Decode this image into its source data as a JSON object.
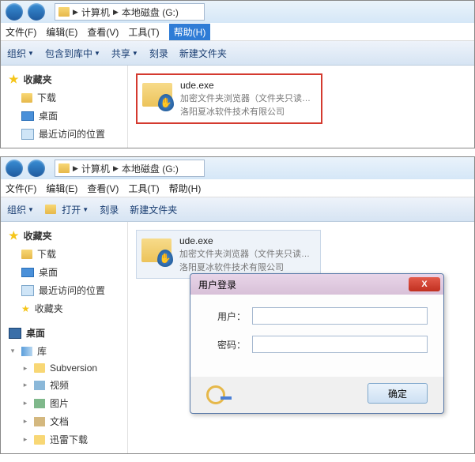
{
  "win1": {
    "breadcrumb": {
      "computer": "计算机",
      "disk": "本地磁盘 (G:)"
    },
    "menu": {
      "file": "文件(F)",
      "edit": "编辑(E)",
      "view": "查看(V)",
      "tools": "工具(T)",
      "help": "帮助(H)",
      "help_active": true
    },
    "toolbar": {
      "organize": "组织",
      "include": "包含到库中",
      "share": "共享",
      "burn": "刻录",
      "newfolder": "新建文件夹"
    },
    "sidebar": {
      "fav": "收藏夹",
      "downloads": "下载",
      "desktop": "桌面",
      "recent": "最近访问的位置"
    },
    "file": {
      "name": "ude.exe",
      "desc1": "加密文件夹浏览器（文件夹只读…",
      "desc2": "洛阳夏冰软件技术有限公司"
    }
  },
  "win2": {
    "breadcrumb": {
      "computer": "计算机",
      "disk": "本地磁盘 (G:)"
    },
    "menu": {
      "file": "文件(F)",
      "edit": "编辑(E)",
      "view": "查看(V)",
      "tools": "工具(T)",
      "help": "帮助(H)"
    },
    "toolbar": {
      "organize": "组织",
      "open": "打开",
      "burn": "刻录",
      "newfolder": "新建文件夹"
    },
    "sidebar": {
      "fav": "收藏夹",
      "downloads": "下载",
      "desktop": "桌面",
      "recent": "最近访问的位置",
      "fav2": "收藏夹",
      "desktop2": "桌面",
      "lib": "库",
      "subversion": "Subversion",
      "video": "视频",
      "pictures": "图片",
      "docs": "文档",
      "xunlei": "迅雷下载"
    },
    "file": {
      "name": "ude.exe",
      "desc1": "加密文件夹浏览器（文件夹只读…",
      "desc2": "洛阳夏冰软件技术有限公司"
    }
  },
  "dialog": {
    "title": "用户登录",
    "user_label": "用户：",
    "pass_label": "密码：",
    "ok": "确定",
    "close": "X"
  }
}
